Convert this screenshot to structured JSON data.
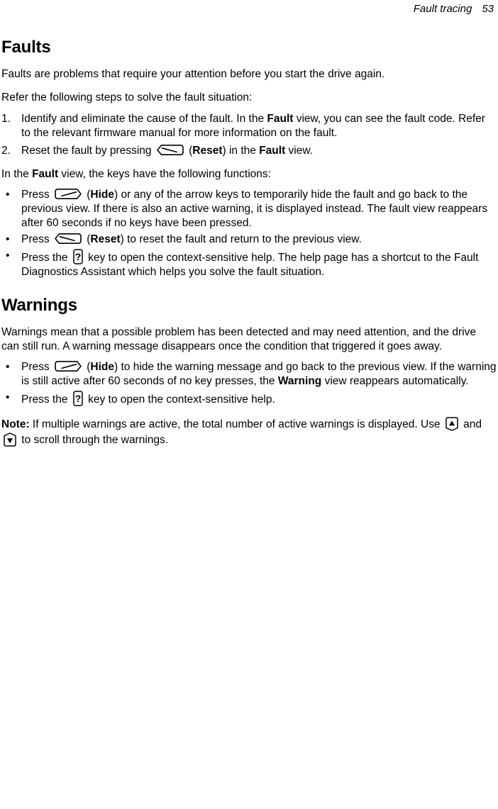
{
  "header": {
    "title": "Fault tracing",
    "page_number": "53"
  },
  "sections": [
    {
      "id": "faults",
      "heading": "Faults",
      "intro": "Faults are problems that require your attention before you start the drive again.",
      "lead_in": "Refer the following steps to solve the fault situation:",
      "steps": [
        {
          "marker": "1.",
          "part1": "Identify and eliminate the cause of the fault. In the ",
          "bold1": "Fault",
          "part2": " view, you can see the fault code. Refer to the relevant firmware manual for more information on the fault."
        },
        {
          "marker": "2.",
          "part1": "Reset the fault by pressing ",
          "icon": "softkey-reset-icon",
          "part2": " (",
          "bold1": "Reset",
          "part3": ") in the ",
          "bold2": "Fault",
          "part4": " view."
        }
      ],
      "keys_lead_in_part1": "In the ",
      "keys_lead_in_bold": "Fault",
      "keys_lead_in_part2": " view, the keys have the following functions:",
      "bullets": [
        {
          "part1": "Press ",
          "icon": "softkey-hide-icon",
          "part2": " (",
          "bold1": "Hide",
          "part3": ") or any of the arrow keys to temporarily hide the fault and go back to the previous view. If there is also an active warning, it is displayed instead. The fault view reappears after 60 seconds if no keys have been pressed."
        },
        {
          "part1": "Press ",
          "icon": "softkey-reset-icon",
          "part2": " (",
          "bold1": "Reset",
          "part3": ") to reset the fault and return to the previous view."
        },
        {
          "part1": "Press the ",
          "icon": "help-question-key-icon",
          "part2": " key to open the context-sensitive help. The help page has a shortcut to the Fault Diagnostics Assistant which helps you solve the fault situation."
        }
      ]
    },
    {
      "id": "warnings",
      "heading": "Warnings",
      "intro": "Warnings mean that a possible problem has been detected and may need attention, and the drive can still run. A warning message disappears once the condition that triggered it goes away.",
      "bullets": [
        {
          "part1": "Press ",
          "icon": "softkey-hide-icon",
          "part2": " (",
          "bold1": "Hide",
          "part3": ") to hide the warning message and go back to the previous view. If the warning is still active after 60 seconds of no key presses, the ",
          "bold2": "Warning",
          "part4": " view reappears automatically."
        },
        {
          "part1": "Press the ",
          "icon": "help-question-key-icon",
          "part2": " key to open the context-sensitive help."
        }
      ],
      "note": {
        "label": "Note:",
        "text1": " If multiple warnings are active, the total number of active warnings is displayed. Use ",
        "icon_up": "arrow-up-key-icon",
        "text2": " and ",
        "icon_down": "arrow-down-key-icon",
        "text3": " to scroll through the warnings."
      }
    }
  ],
  "icons": {
    "help_key_glyph": "?",
    "bullet_glyph": "•"
  },
  "colors": {
    "text": "#000000",
    "background": "#ffffff"
  }
}
